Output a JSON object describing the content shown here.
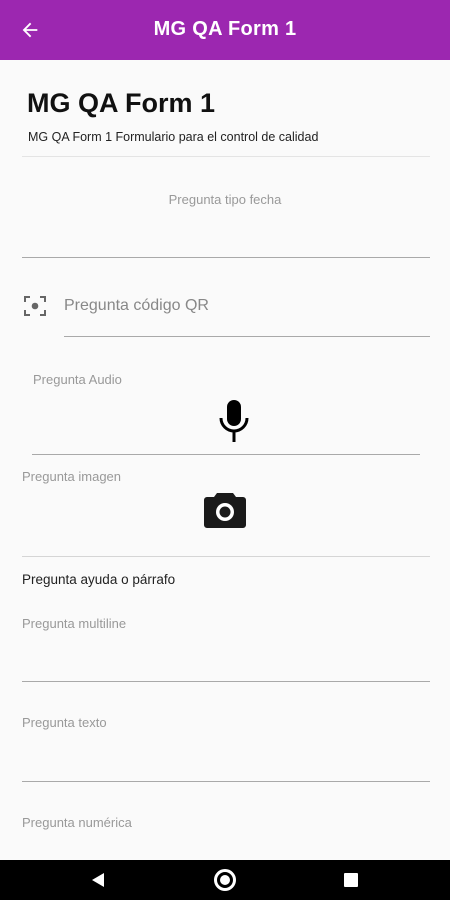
{
  "appbar": {
    "title": "MG QA Form 1",
    "back_icon": "arrow-back-icon",
    "color": "#9c27b0"
  },
  "form": {
    "title": "MG QA Form 1",
    "description": "MG QA Form 1 Formulario para el control de calidad"
  },
  "fields": {
    "date": {
      "label": "Pregunta tipo fecha",
      "value": ""
    },
    "qr": {
      "placeholder": "Pregunta código QR",
      "icon": "qr-scan-icon"
    },
    "audio": {
      "label": "Pregunta Audio",
      "icon": "microphone-icon"
    },
    "image": {
      "label": "Pregunta imagen",
      "icon": "camera-icon"
    },
    "help": {
      "text": "Pregunta ayuda o párrafo"
    },
    "multiline": {
      "label": "Pregunta multiline",
      "value": ""
    },
    "texto": {
      "label": "Pregunta texto",
      "value": ""
    },
    "numerica": {
      "label": "Pregunta numérica",
      "value": ""
    }
  },
  "navbar": {
    "back_icon": "nav-back-icon",
    "home_icon": "nav-home-icon",
    "recents_icon": "nav-recents-icon"
  }
}
